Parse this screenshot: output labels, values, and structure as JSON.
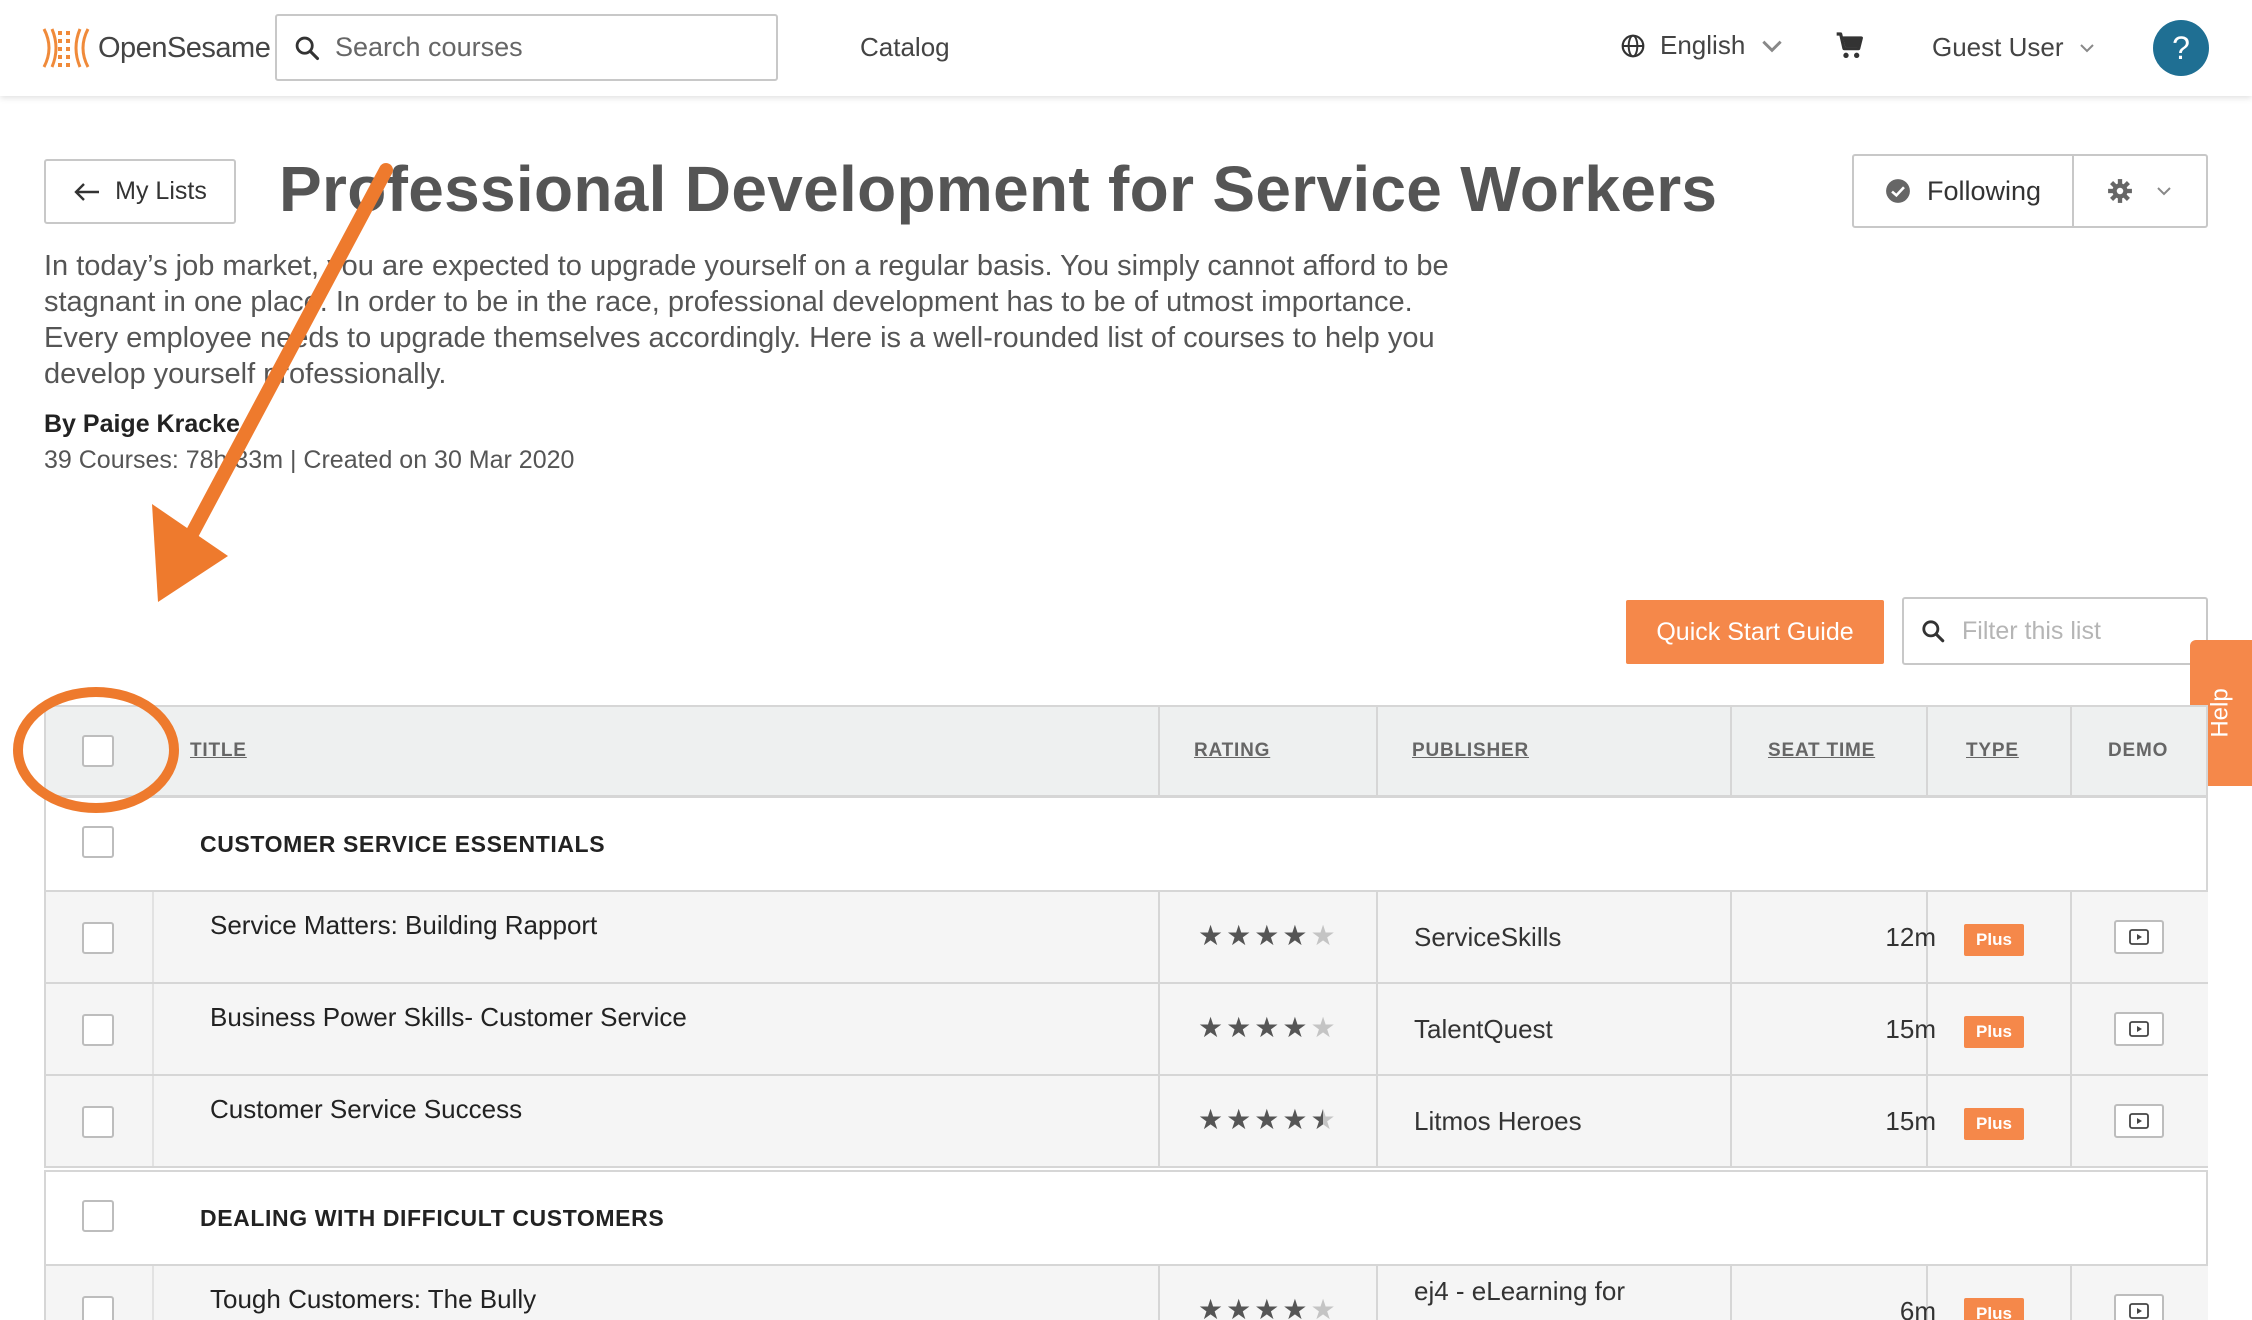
{
  "header": {
    "logo_text": "OpenSesame",
    "search_placeholder": "Search courses",
    "catalog": "Catalog",
    "language": "English",
    "user": "Guest User",
    "help_icon": "?"
  },
  "page": {
    "back_label": "My Lists",
    "title": "Professional Development for Service Workers",
    "following_label": "Following",
    "description": "In today’s job market, you are expected to upgrade yourself on a regular basis. You simply cannot afford to be stagnant in one place. In order to be in the race, professional development has to be of utmost importance. Every employee needs to upgrade themselves accordingly. Here is a well-rounded list of courses to help you develop yourself professionally.",
    "author": "By Paige Kracke",
    "meta": "39 Courses: 78h 33m | Created on 30 Mar 2020",
    "quick_start": "Quick Start Guide",
    "filter_placeholder": "Filter this list",
    "help_tab": "Help"
  },
  "table": {
    "columns": {
      "title": "TITLE",
      "rating": "RATING",
      "publisher": "PUBLISHER",
      "seat_time": "SEAT TIME",
      "type": "TYPE",
      "demo": "DEMO"
    },
    "groups": [
      {
        "name": "CUSTOMER SERVICE ESSENTIALS",
        "courses": [
          {
            "title": "Service Matters: Building Rapport",
            "rating": 4,
            "publisher": "ServiceSkills",
            "seat_time": "12m",
            "type": "Plus"
          },
          {
            "title": "Business Power Skills- Customer Service",
            "rating": 4,
            "publisher": "TalentQuest",
            "seat_time": "15m",
            "type": "Plus"
          },
          {
            "title": "Customer Service Success",
            "rating": 4.5,
            "publisher": "Litmos Heroes",
            "seat_time": "15m",
            "type": "Plus"
          }
        ]
      },
      {
        "name": "DEALING WITH DIFFICULT CUSTOMERS",
        "courses": [
          {
            "title": "Tough Customers: The Bully",
            "rating": 4,
            "publisher": "ej4 - eLearning for",
            "seat_time": "6m",
            "type": "Plus"
          }
        ]
      }
    ]
  },
  "colors": {
    "accent_orange": "#f5884a",
    "annotation_orange": "#ee7a2d",
    "help_blue": "#1f6f93"
  },
  "icons": [
    "logo-icon",
    "search-icon",
    "globe-icon",
    "chevron-down-icon",
    "cart-icon",
    "help-icon",
    "arrow-left-icon",
    "check-circle-icon",
    "gear-icon",
    "filter-search-icon",
    "play-icon",
    "star-icon"
  ]
}
